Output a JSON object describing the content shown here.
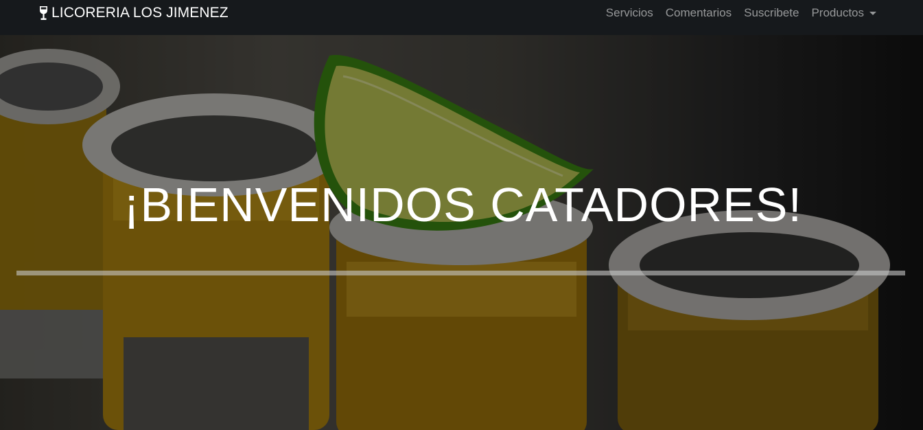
{
  "navbar": {
    "brand": "LICORERIA LOS JIMENEZ",
    "brand_icon": "wine-glass-icon",
    "links": [
      {
        "label": "Servicios"
      },
      {
        "label": "Comentarios"
      },
      {
        "label": "Suscribete"
      },
      {
        "label": "Productos",
        "dropdown": true
      }
    ]
  },
  "hero": {
    "title": "¡BIENVENIDOS CATADORES!",
    "background": "tequila-shots-with-lime-photo"
  },
  "colors": {
    "navbar_bg": "#16191c",
    "nav_link": "rgba(255,255,255,0.55)",
    "brand_text": "#ffffff",
    "hero_text": "#ffffff"
  }
}
